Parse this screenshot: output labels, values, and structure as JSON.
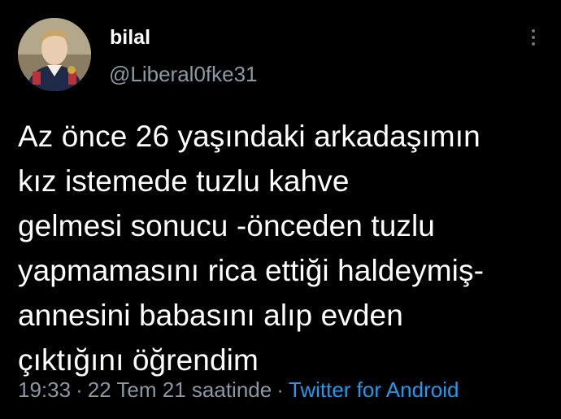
{
  "tweet": {
    "author": {
      "name": "bilal",
      "handle": "@Liberal0fke31",
      "avatar_icon": "portrait-avatar"
    },
    "more_icon": "more-vertical-icon",
    "text": "Az önce 26 yaşındaki arkadaşımın\nkız istemede tuzlu kahve\ngelmesi sonucu -önceden tuzlu\nyapmamasını rica ettiği haldeymiş-\nannesini babasını alıp evden\nçıktığını öğrendim",
    "time": "19:33",
    "separator": "·",
    "date": "22 Tem 21 saatinde",
    "client": "Twitter for Android"
  },
  "colors": {
    "background": "#000000",
    "text": "#ffffff",
    "secondary": "#8b98a5",
    "link": "#1d9bf0"
  }
}
